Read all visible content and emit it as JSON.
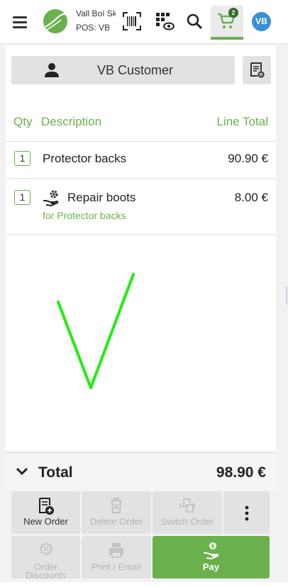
{
  "header": {
    "store_name": "Vall Boí Ski",
    "pos_name": "POS: VB",
    "cart_count": "2",
    "user_initials": "VB",
    "icons": [
      "menu-icon",
      "barcode-scan-icon",
      "qr-view-icon",
      "search-icon",
      "cart-icon"
    ]
  },
  "customer": {
    "label": "VB Customer"
  },
  "columns": {
    "qty": "Qty",
    "description": "Description",
    "line_total": "Line Total"
  },
  "lines": [
    {
      "qty": "1",
      "description": "Protector backs",
      "total": "90.90 €"
    },
    {
      "qty": "1",
      "description": "Repair boots",
      "total": "8.00 €",
      "sub": "for Protector backs"
    }
  ],
  "totals": {
    "label": "Total",
    "value": "98.90 €"
  },
  "actions": {
    "new_order": "New Order",
    "delete_order": "Delete Order",
    "switch_order": "Switch Order",
    "order_discounts_1": "Order",
    "order_discounts_2": "Discounts",
    "print_email": "Print / Email",
    "pay": "Pay"
  },
  "colors": {
    "accent": "#6ab04c",
    "avatar": "#3a8fd6",
    "signature": "#22ee11"
  }
}
